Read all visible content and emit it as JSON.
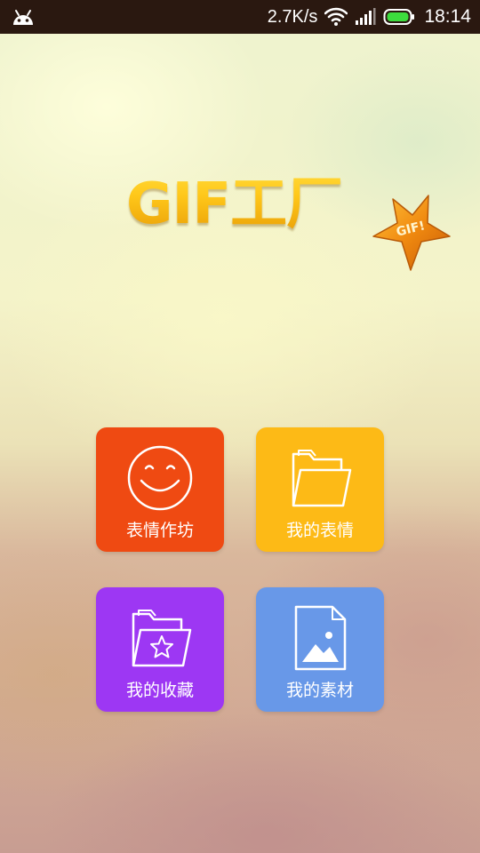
{
  "status_bar": {
    "network_speed": "2.7K/s",
    "time": "18:14",
    "icons": [
      "android-icon",
      "wifi-icon",
      "signal-icon",
      "battery-icon"
    ],
    "background": "#2a1810"
  },
  "logo": {
    "title": "GIF工厂",
    "badge_text": "GIF!"
  },
  "tiles": [
    {
      "label": "表情作坊",
      "icon": "smiley-icon",
      "color": "#ef4a12"
    },
    {
      "label": "我的表情",
      "icon": "folder-icon",
      "color": "#fdba16"
    },
    {
      "label": "我的收藏",
      "icon": "folder-star-icon",
      "color": "#9d37f3"
    },
    {
      "label": "我的素材",
      "icon": "image-file-icon",
      "color": "#6898e8"
    }
  ]
}
